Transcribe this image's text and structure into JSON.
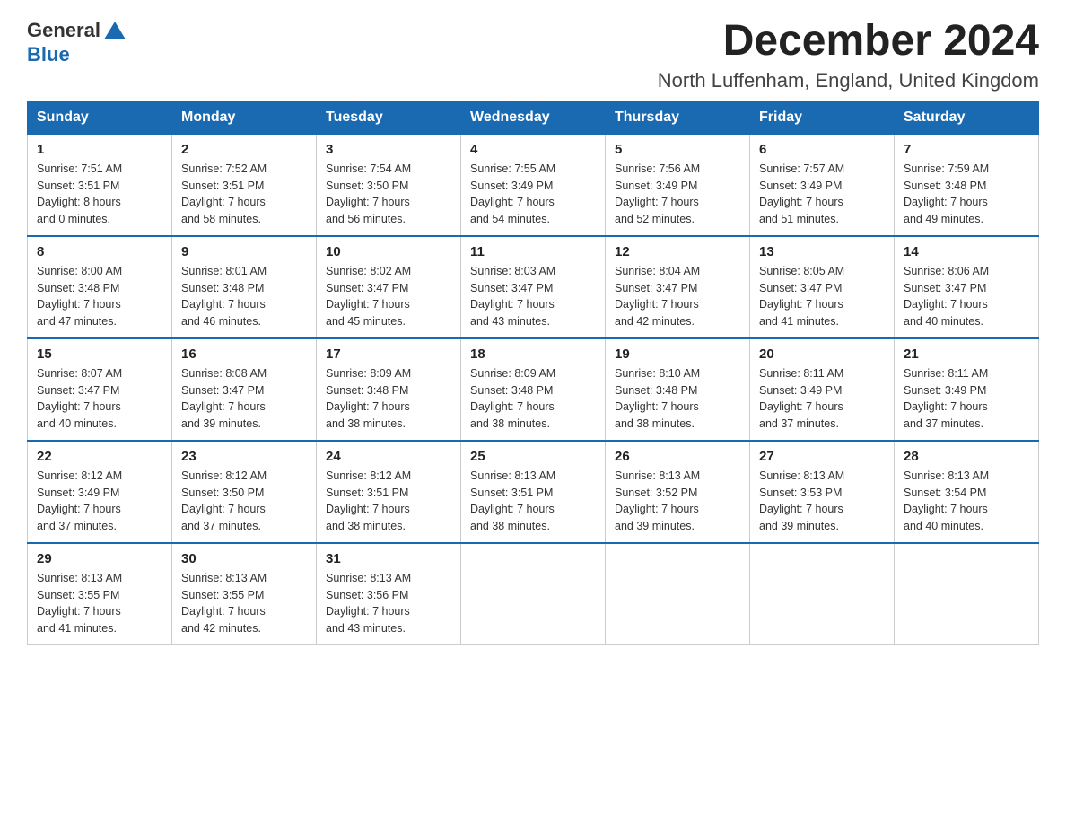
{
  "header": {
    "logo_general": "General",
    "logo_blue": "Blue",
    "month": "December 2024",
    "location": "North Luffenham, England, United Kingdom"
  },
  "weekdays": [
    "Sunday",
    "Monday",
    "Tuesday",
    "Wednesday",
    "Thursday",
    "Friday",
    "Saturday"
  ],
  "weeks": [
    [
      {
        "day": "1",
        "sunrise": "7:51 AM",
        "sunset": "3:51 PM",
        "daylight": "8 hours and 0 minutes."
      },
      {
        "day": "2",
        "sunrise": "7:52 AM",
        "sunset": "3:51 PM",
        "daylight": "7 hours and 58 minutes."
      },
      {
        "day": "3",
        "sunrise": "7:54 AM",
        "sunset": "3:50 PM",
        "daylight": "7 hours and 56 minutes."
      },
      {
        "day": "4",
        "sunrise": "7:55 AM",
        "sunset": "3:49 PM",
        "daylight": "7 hours and 54 minutes."
      },
      {
        "day": "5",
        "sunrise": "7:56 AM",
        "sunset": "3:49 PM",
        "daylight": "7 hours and 52 minutes."
      },
      {
        "day": "6",
        "sunrise": "7:57 AM",
        "sunset": "3:49 PM",
        "daylight": "7 hours and 51 minutes."
      },
      {
        "day": "7",
        "sunrise": "7:59 AM",
        "sunset": "3:48 PM",
        "daylight": "7 hours and 49 minutes."
      }
    ],
    [
      {
        "day": "8",
        "sunrise": "8:00 AM",
        "sunset": "3:48 PM",
        "daylight": "7 hours and 47 minutes."
      },
      {
        "day": "9",
        "sunrise": "8:01 AM",
        "sunset": "3:48 PM",
        "daylight": "7 hours and 46 minutes."
      },
      {
        "day": "10",
        "sunrise": "8:02 AM",
        "sunset": "3:47 PM",
        "daylight": "7 hours and 45 minutes."
      },
      {
        "day": "11",
        "sunrise": "8:03 AM",
        "sunset": "3:47 PM",
        "daylight": "7 hours and 43 minutes."
      },
      {
        "day": "12",
        "sunrise": "8:04 AM",
        "sunset": "3:47 PM",
        "daylight": "7 hours and 42 minutes."
      },
      {
        "day": "13",
        "sunrise": "8:05 AM",
        "sunset": "3:47 PM",
        "daylight": "7 hours and 41 minutes."
      },
      {
        "day": "14",
        "sunrise": "8:06 AM",
        "sunset": "3:47 PM",
        "daylight": "7 hours and 40 minutes."
      }
    ],
    [
      {
        "day": "15",
        "sunrise": "8:07 AM",
        "sunset": "3:47 PM",
        "daylight": "7 hours and 40 minutes."
      },
      {
        "day": "16",
        "sunrise": "8:08 AM",
        "sunset": "3:47 PM",
        "daylight": "7 hours and 39 minutes."
      },
      {
        "day": "17",
        "sunrise": "8:09 AM",
        "sunset": "3:48 PM",
        "daylight": "7 hours and 38 minutes."
      },
      {
        "day": "18",
        "sunrise": "8:09 AM",
        "sunset": "3:48 PM",
        "daylight": "7 hours and 38 minutes."
      },
      {
        "day": "19",
        "sunrise": "8:10 AM",
        "sunset": "3:48 PM",
        "daylight": "7 hours and 38 minutes."
      },
      {
        "day": "20",
        "sunrise": "8:11 AM",
        "sunset": "3:49 PM",
        "daylight": "7 hours and 37 minutes."
      },
      {
        "day": "21",
        "sunrise": "8:11 AM",
        "sunset": "3:49 PM",
        "daylight": "7 hours and 37 minutes."
      }
    ],
    [
      {
        "day": "22",
        "sunrise": "8:12 AM",
        "sunset": "3:49 PM",
        "daylight": "7 hours and 37 minutes."
      },
      {
        "day": "23",
        "sunrise": "8:12 AM",
        "sunset": "3:50 PM",
        "daylight": "7 hours and 37 minutes."
      },
      {
        "day": "24",
        "sunrise": "8:12 AM",
        "sunset": "3:51 PM",
        "daylight": "7 hours and 38 minutes."
      },
      {
        "day": "25",
        "sunrise": "8:13 AM",
        "sunset": "3:51 PM",
        "daylight": "7 hours and 38 minutes."
      },
      {
        "day": "26",
        "sunrise": "8:13 AM",
        "sunset": "3:52 PM",
        "daylight": "7 hours and 39 minutes."
      },
      {
        "day": "27",
        "sunrise": "8:13 AM",
        "sunset": "3:53 PM",
        "daylight": "7 hours and 39 minutes."
      },
      {
        "day": "28",
        "sunrise": "8:13 AM",
        "sunset": "3:54 PM",
        "daylight": "7 hours and 40 minutes."
      }
    ],
    [
      {
        "day": "29",
        "sunrise": "8:13 AM",
        "sunset": "3:55 PM",
        "daylight": "7 hours and 41 minutes."
      },
      {
        "day": "30",
        "sunrise": "8:13 AM",
        "sunset": "3:55 PM",
        "daylight": "7 hours and 42 minutes."
      },
      {
        "day": "31",
        "sunrise": "8:13 AM",
        "sunset": "3:56 PM",
        "daylight": "7 hours and 43 minutes."
      },
      null,
      null,
      null,
      null
    ]
  ],
  "labels": {
    "sunrise": "Sunrise:",
    "sunset": "Sunset:",
    "daylight": "Daylight:"
  }
}
